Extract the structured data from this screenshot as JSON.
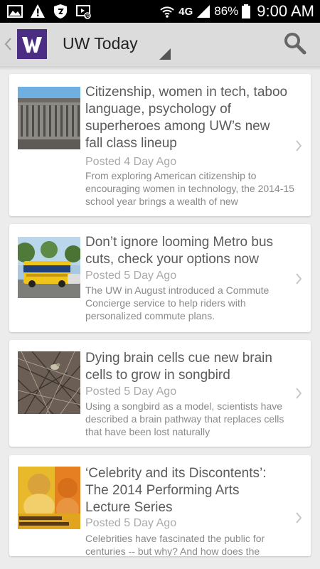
{
  "status_bar": {
    "network": "4G",
    "battery": "86%",
    "time": "9:00 AM",
    "icons": [
      "image-icon",
      "warning-icon",
      "shield-icon",
      "cast-icon",
      "wifi-icon",
      "signal-icon",
      "battery-icon"
    ]
  },
  "action_bar": {
    "title": "UW Today",
    "logo": "W",
    "icons": [
      "up-caret-icon",
      "dropdown-corner-icon",
      "search-icon"
    ]
  },
  "articles": [
    {
      "title": "Citizenship, women in tech, taboo language, psychology of superheroes among UW’s new fall class lineup",
      "meta": "Posted 4 Day Ago",
      "summary": "From exploring American citizenship to encouraging women in technology, the 2014-15 school year brings a wealth of new"
    },
    {
      "title": "Don’t ignore looming Metro bus cuts, check your options now",
      "meta": "Posted 5 Day Ago",
      "summary": "The UW in August introduced a Commute Concierge service to help riders with personalized commute plans."
    },
    {
      "title": "Dying brain cells cue new brain cells to grow in songbird",
      "meta": "Posted 5 Day Ago",
      "summary": "Using a songbird as a model, scientists have described a brain pathway that replaces cells that have been lost naturally"
    },
    {
      "title": "‘Celebrity and its Discontents’: The 2014 Performing Arts Lecture Series",
      "meta": "Posted 5 Day Ago",
      "summary": "Celebrities have fascinated the public for centuries -- but why? And how does the"
    }
  ],
  "colors": {
    "brand_purple": "#4b2e83",
    "status_bar": "#000000",
    "action_bar": "#dcdcdc",
    "background": "#ececec",
    "title_text": "#5b5b5b",
    "meta_text": "#aaaaaa"
  }
}
